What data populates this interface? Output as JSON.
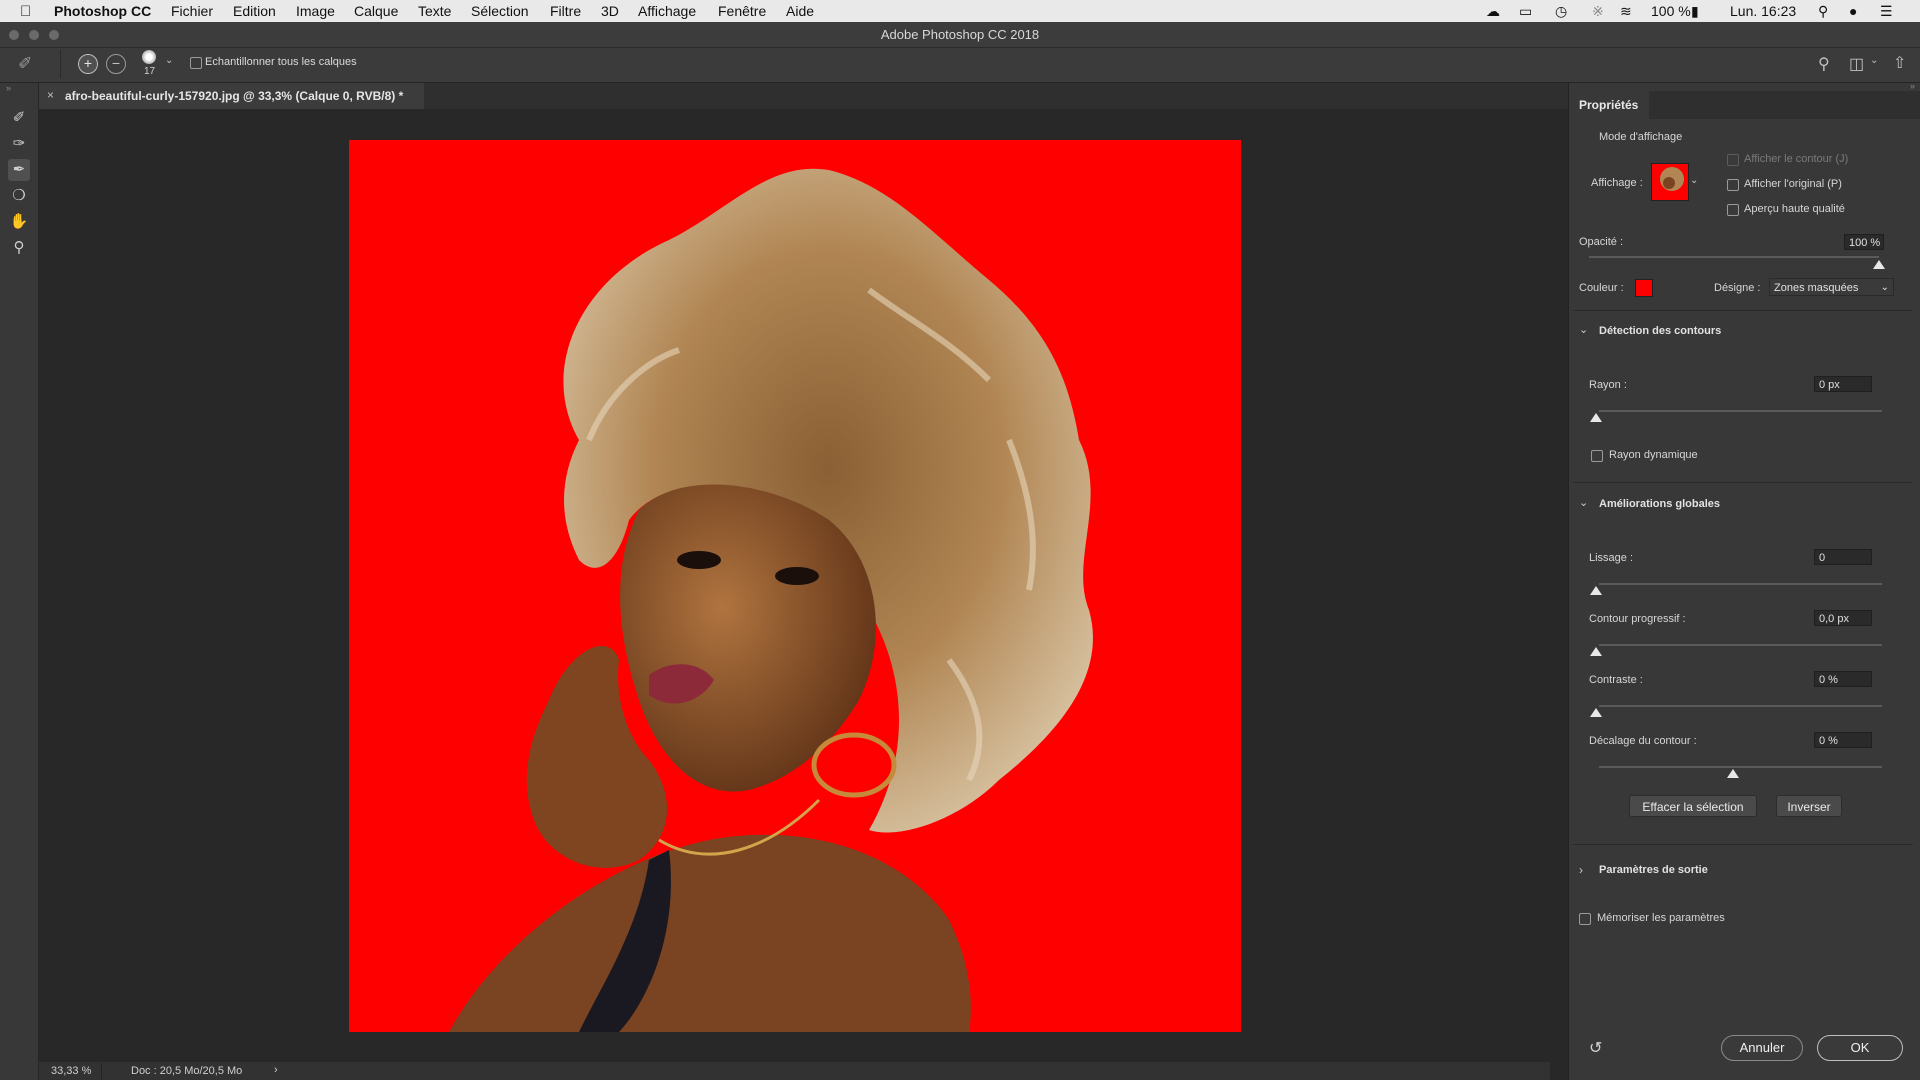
{
  "menubar": {
    "app_name": "Photoshop CC",
    "items": [
      "Fichier",
      "Edition",
      "Image",
      "Calque",
      "Texte",
      "Sélection",
      "Filtre",
      "3D",
      "Affichage",
      "Fenêtre",
      "Aide"
    ],
    "battery": "100 %",
    "clock": "Lun. 16:23"
  },
  "window": {
    "title": "Adobe Photoshop CC 2018"
  },
  "options": {
    "brush_size": "17",
    "sample_all_layers_label": "Echantillonner tous les calques"
  },
  "document": {
    "tab_title": "afro-beautiful-curly-157920.jpg @ 33,3% (Calque 0, RVB/8) *",
    "tab_close": "×"
  },
  "status": {
    "zoom": "33,33 %",
    "doc_size": "Doc : 20,5 Mo/20,5 Mo",
    "arrow": "›"
  },
  "panel": {
    "title": "Propriétés",
    "view_mode_heading": "Mode d'affichage",
    "view_label": "Affichage :",
    "show_edge_label": "Afficher le contour (J)",
    "show_original_label": "Afficher l'original (P)",
    "high_quality_label": "Aperçu haute qualité",
    "opacity_label": "Opacité :",
    "opacity_value": "100 %",
    "opacity_level": 1.0,
    "color_label": "Couleur :",
    "overlay_color": "#ff0000",
    "indicates_label": "Désigne :",
    "indicates_value": "Zones masquées",
    "edge_detection_heading": "Détection des contours",
    "radius_label": "Rayon :",
    "radius_value": "0 px",
    "smart_radius_label": "Rayon dynamique",
    "global_heading": "Améliorations globales",
    "smooth_label": "Lissage :",
    "smooth_value": "0",
    "feather_label": "Contour progressif :",
    "feather_value": "0,0 px",
    "contrast_label": "Contraste :",
    "contrast_value": "0 %",
    "shift_label": "Décalage du contour :",
    "shift_value": "0 %",
    "clear_button": "Effacer la sélection",
    "invert_button": "Inverser",
    "output_heading": "Paramètres de sortie",
    "remember_label": "Mémoriser les paramètres",
    "cancel_button": "Annuler",
    "ok_button": "OK"
  },
  "colors": {
    "accent_red": "#ff0000",
    "panel_bg": "#383838",
    "canvas_bg": "#282828"
  }
}
